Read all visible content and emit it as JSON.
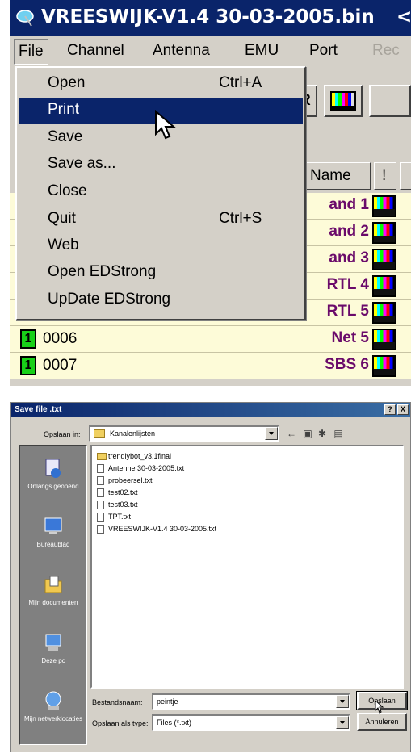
{
  "app": {
    "title": "VREESWIJK-V1.4 30-03-2005.bin",
    "title_extra": "<",
    "menubar": [
      {
        "label": "File",
        "enabled": true
      },
      {
        "label": "Channel",
        "enabled": true
      },
      {
        "label": "Antenna",
        "enabled": true
      },
      {
        "label": "EMU",
        "enabled": true
      },
      {
        "label": "Port",
        "enabled": true
      },
      {
        "label": "Rec",
        "enabled": false
      }
    ],
    "file_menu": [
      {
        "label": "Open",
        "shortcut": "Ctrl+A"
      },
      {
        "label": "Print",
        "shortcut": "",
        "selected": true
      },
      {
        "label": "Save",
        "shortcut": ""
      },
      {
        "label": "Save as...",
        "shortcut": ""
      },
      {
        "label": "Close",
        "shortcut": ""
      },
      {
        "label": "Quit",
        "shortcut": "Ctrl+S"
      },
      {
        "label": "Web",
        "shortcut": ""
      },
      {
        "label": "Open EDStrong",
        "shortcut": ""
      },
      {
        "label": "UpDate EDStrong",
        "shortcut": ""
      }
    ],
    "toolbar": {
      "sr_label": "SR"
    },
    "table": {
      "headers": {
        "name": "Name",
        "flag": "!"
      },
      "rows": [
        {
          "badge": "",
          "number": "",
          "name": "and 1"
        },
        {
          "badge": "",
          "number": "",
          "name": "and 2"
        },
        {
          "badge": "",
          "number": "",
          "name": "and 3"
        },
        {
          "badge": "",
          "number": "",
          "name": "RTL 4"
        },
        {
          "badge": "",
          "number": "",
          "name": "RTL 5"
        },
        {
          "badge": "1",
          "number": "0006",
          "name": "Net 5"
        },
        {
          "badge": "1",
          "number": "0007",
          "name": "SBS 6"
        }
      ]
    },
    "colors": {
      "title_bar": "#0a246a",
      "menu_face": "#d4d0c8",
      "row_bg": "#fdfbd8",
      "channel_name": "#6a0a6a",
      "badge": "#18d018"
    }
  },
  "save_dialog": {
    "title": "Save file .txt",
    "help_glyph": "?",
    "close_glyph": "X",
    "look_in_label": "Opslaan in:",
    "look_in_value": "Kanalenlijsten",
    "places": [
      "Onlangs geopend",
      "Bureaublad",
      "Mijn documenten",
      "Deze pc",
      "Mijn netwerklocaties"
    ],
    "files": [
      {
        "name": "trendlybot_v3.1final",
        "type": "folder"
      },
      {
        "name": "Antenne 30-03-2005.txt",
        "type": "file"
      },
      {
        "name": "probeersel.txt",
        "type": "file"
      },
      {
        "name": "test02.txt",
        "type": "file"
      },
      {
        "name": "test03.txt",
        "type": "file"
      },
      {
        "name": "TPT.txt",
        "type": "file"
      },
      {
        "name": "VREESWIJK-V1.4 30-03-2005.txt",
        "type": "file"
      }
    ],
    "filename_label": "Bestandsnaam:",
    "filename_value": "peintje",
    "filetype_label": "Opslaan als type:",
    "filetype_value": "Files (*.txt)",
    "save_button": "Opslaan",
    "cancel_button": "Annuleren"
  }
}
